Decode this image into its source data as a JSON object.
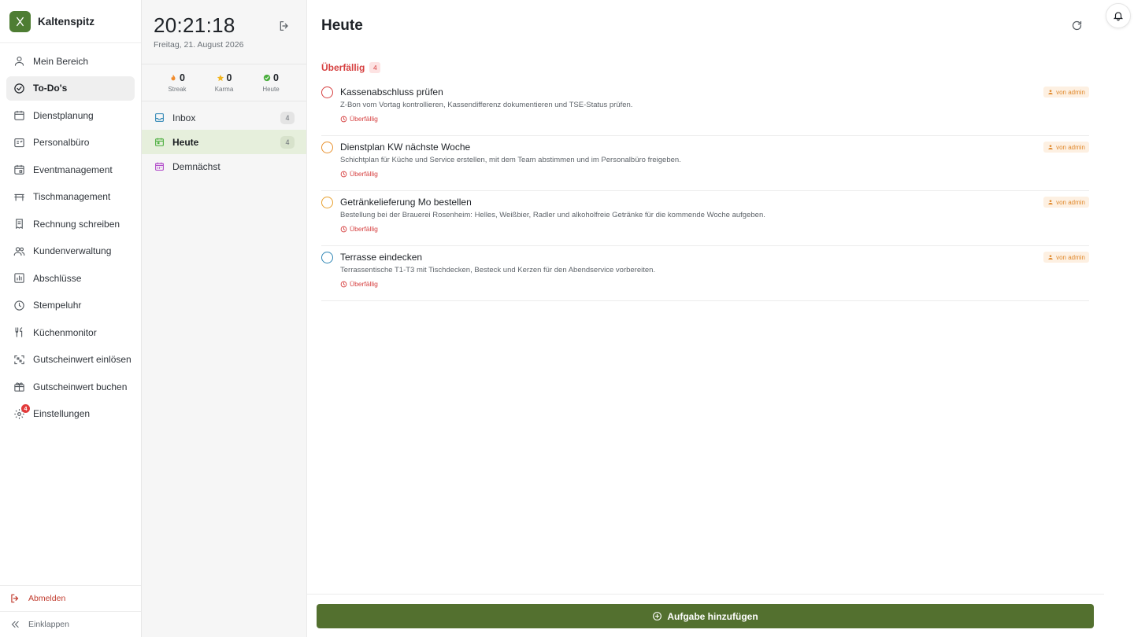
{
  "brand": {
    "name": "Kaltenspitz",
    "color": "#4e7d33"
  },
  "nav": {
    "items": [
      {
        "label": "Mein Bereich",
        "icon": "user-icon"
      },
      {
        "label": "To-Do's",
        "icon": "check-circle-icon",
        "active": true
      },
      {
        "label": "Dienstplanung",
        "icon": "calendar-icon"
      },
      {
        "label": "Personalbüro",
        "icon": "id-card-icon"
      },
      {
        "label": "Eventmanagement",
        "icon": "calendar-event-icon"
      },
      {
        "label": "Tischmanagement",
        "icon": "table-icon"
      },
      {
        "label": "Rechnung schreiben",
        "icon": "receipt-icon"
      },
      {
        "label": "Kundenverwaltung",
        "icon": "users-icon"
      },
      {
        "label": "Abschlüsse",
        "icon": "bar-chart-icon"
      },
      {
        "label": "Stempeluhr",
        "icon": "clock-icon"
      },
      {
        "label": "Küchenmonitor",
        "icon": "cutlery-icon"
      },
      {
        "label": "Gutscheinwert einlösen",
        "icon": "scan-icon"
      },
      {
        "label": "Gutscheinwert buchen",
        "icon": "gift-icon"
      },
      {
        "label": "Einstellungen",
        "icon": "gear-icon",
        "badge": "4"
      }
    ],
    "logout_label": "Abmelden",
    "collapse_label": "Einklappen"
  },
  "panel": {
    "time": "20:21:18",
    "date": "Freitag, 21. August 2026",
    "stats": [
      {
        "value": "0",
        "label": "Streak",
        "icon": "flame-icon"
      },
      {
        "value": "0",
        "label": "Karma",
        "icon": "star-icon"
      },
      {
        "value": "0",
        "label": "Heute",
        "icon": "check-badge-icon"
      }
    ],
    "lists": [
      {
        "label": "Inbox",
        "count": "4",
        "icon": "inbox-icon"
      },
      {
        "label": "Heute",
        "count": "4",
        "icon": "calendar-today-icon",
        "active": true
      },
      {
        "label": "Demnächst",
        "count": "",
        "icon": "calendar-upcoming-icon"
      }
    ]
  },
  "main": {
    "title": "Heute",
    "section": {
      "title": "Überfällig",
      "count": "4"
    },
    "tasks": [
      {
        "title": "Kassenabschluss prüfen",
        "description": "Z-Bon vom Vortag kontrollieren, Kassendifferenz dokumentieren und TSE-Status prüfen.",
        "due": "Überfällig",
        "tag": "von admin",
        "priority_color": "#d64040"
      },
      {
        "title": "Dienstplan KW nächste Woche",
        "description": "Schichtplan für Küche und Service erstellen, mit dem Team abstimmen und im Personalbüro freigeben.",
        "due": "Überfällig",
        "tag": "von admin",
        "priority_color": "#e8912f"
      },
      {
        "title": "Getränkelieferung Mo bestellen",
        "description": "Bestellung bei der Brauerei Rosenheim: Helles, Weißbier, Radler und alkoholfreie Getränke für die kommende Woche aufgeben.",
        "due": "Überfällig",
        "tag": "von admin",
        "priority_color": "#e8a02f"
      },
      {
        "title": "Terrasse eindecken",
        "description": "Terrassentische T1-T3 mit Tischdecken, Besteck und Kerzen für den Abendservice vorbereiten.",
        "due": "Überfällig",
        "tag": "von admin",
        "priority_color": "#2f86b5"
      }
    ],
    "add_button_label": "Aufgabe hinzufügen"
  },
  "colors": {
    "accent_green": "#53702f",
    "overdue_red": "#d64040",
    "tag_orange": "#e08a2e"
  }
}
